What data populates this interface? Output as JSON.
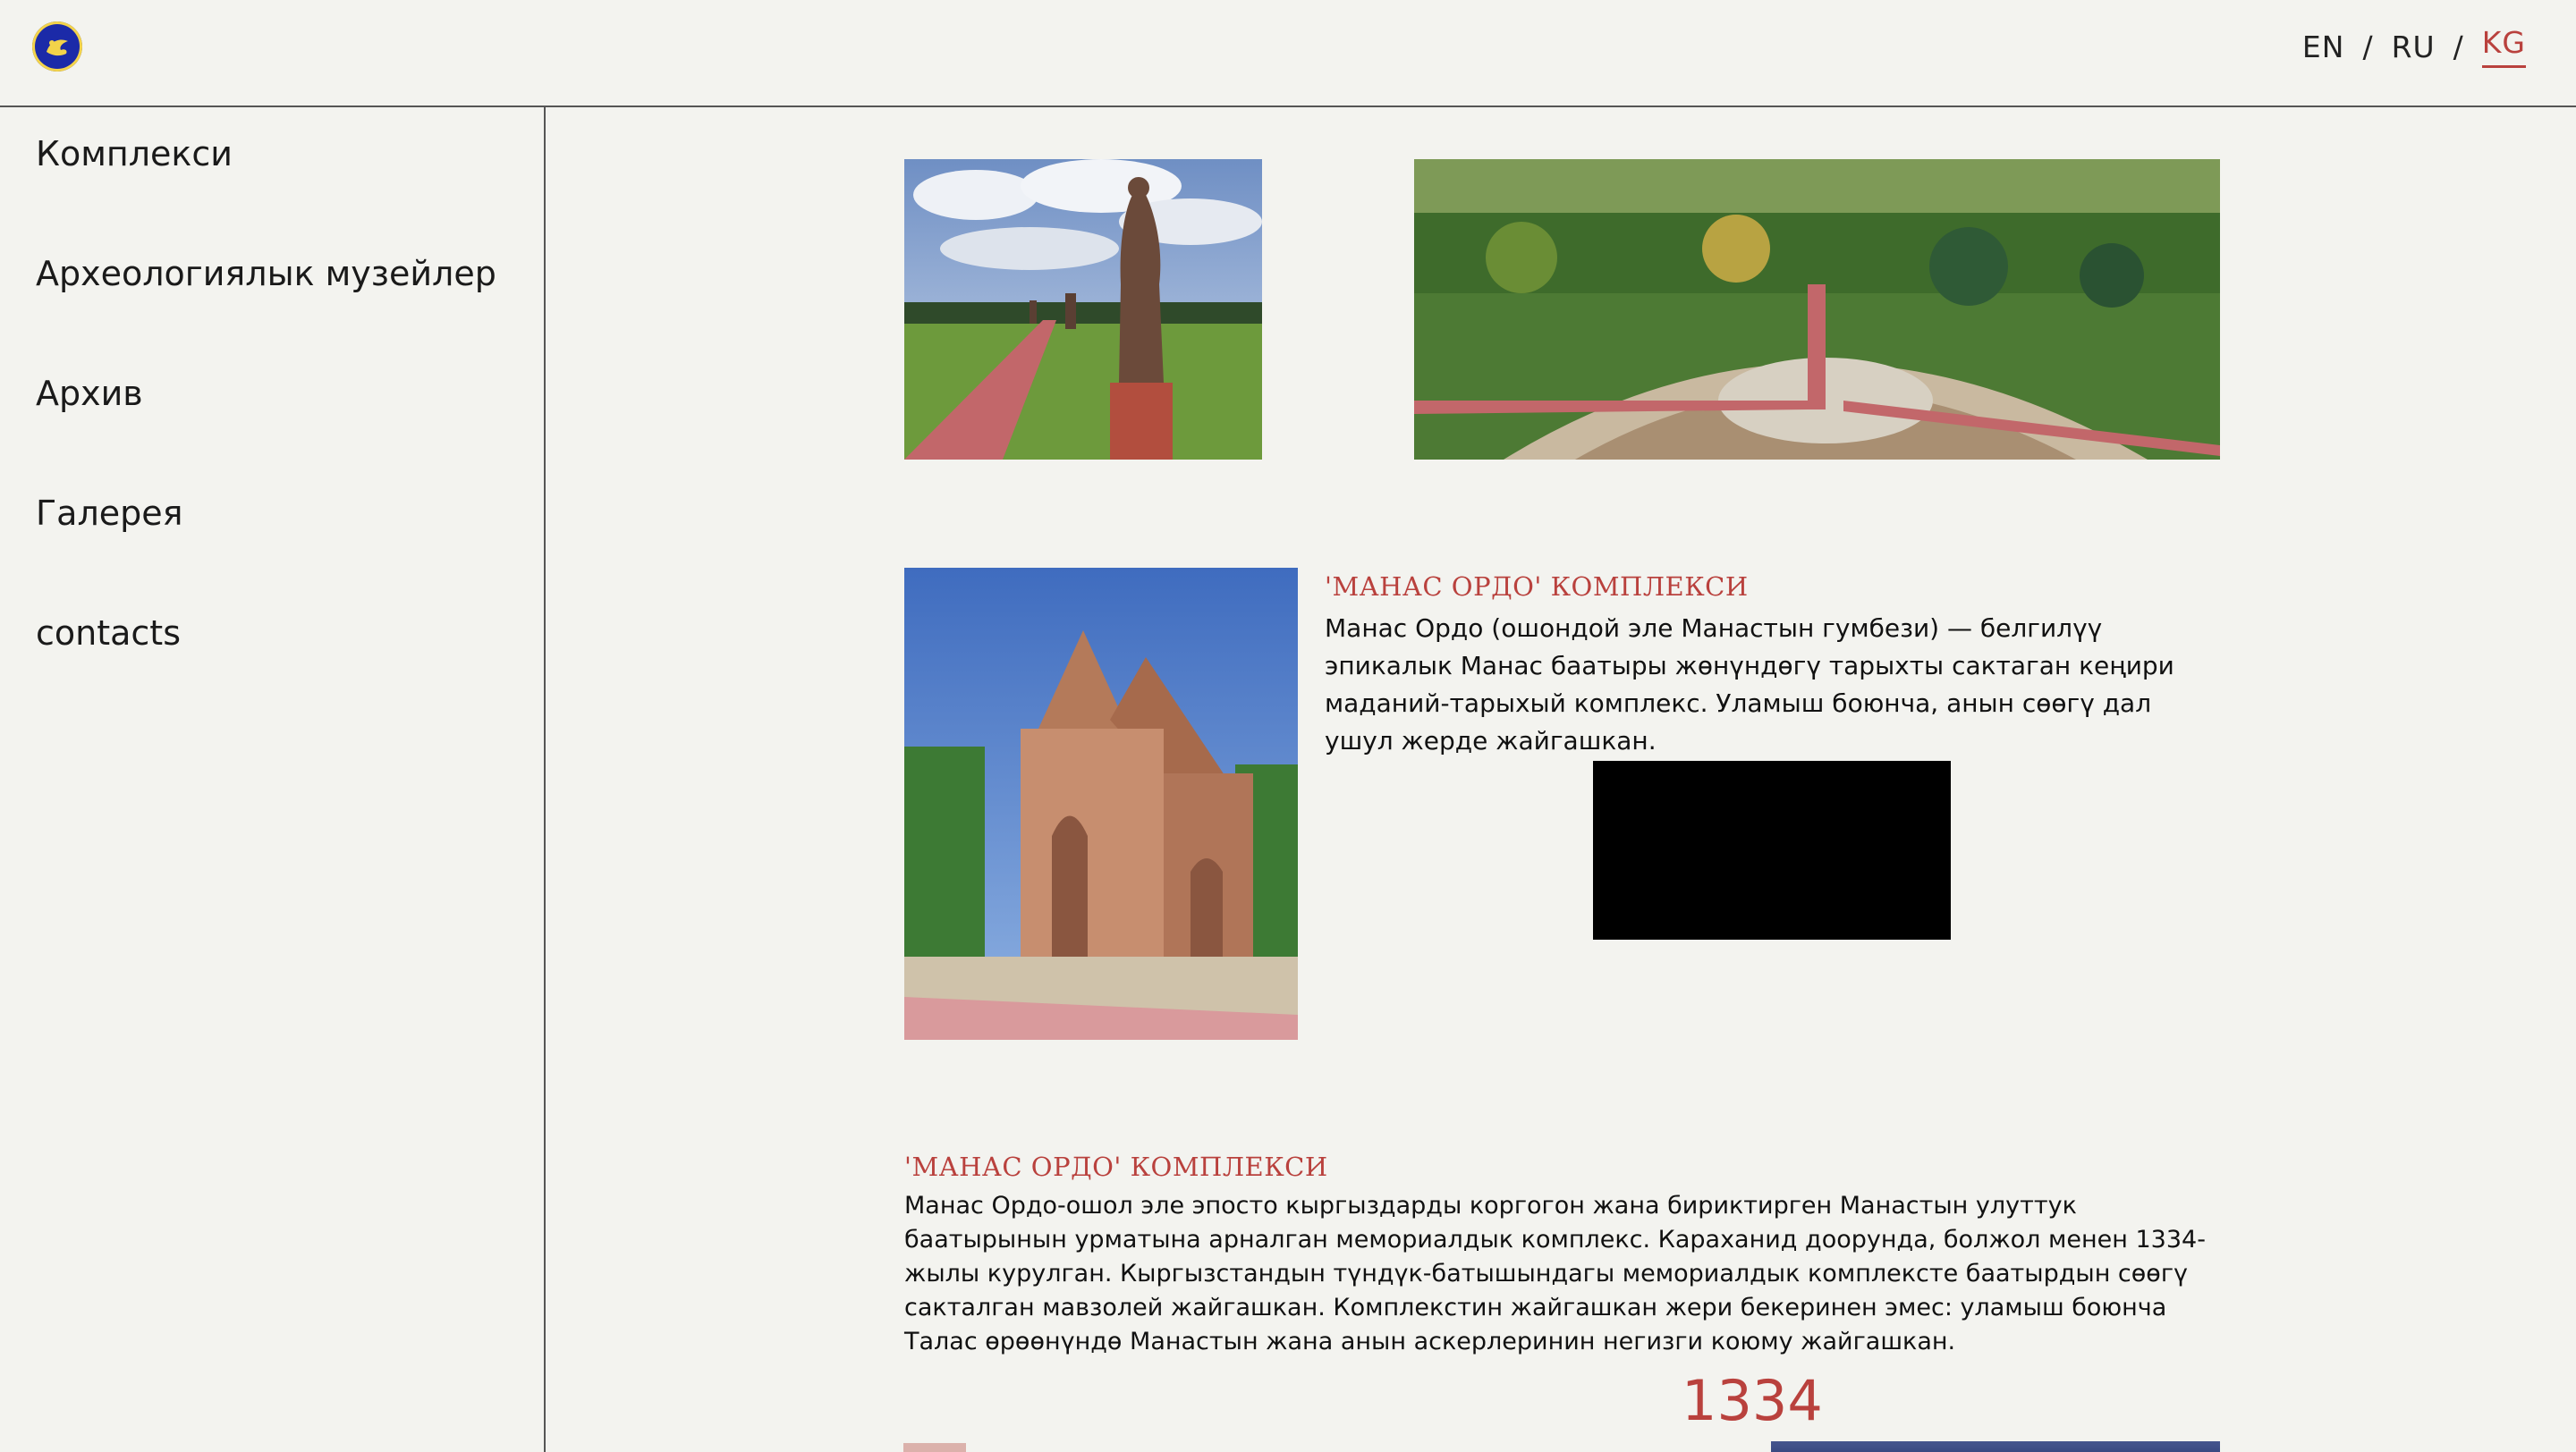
{
  "header": {
    "languages": [
      {
        "label": "EN"
      },
      {
        "label": "RU"
      },
      {
        "label": "KG"
      }
    ],
    "separator": "/",
    "active_language": "KG",
    "colors": {
      "accent": "#b9413d"
    }
  },
  "sidebar": {
    "items": [
      {
        "label": "Комплекси"
      },
      {
        "label": "Археологиялык музейлер"
      },
      {
        "label": "Архив"
      },
      {
        "label": "Галерея"
      },
      {
        "label": "contacts"
      }
    ]
  },
  "main": {
    "section1": {
      "title": "'МАНАС ОРДО' КОМПЛЕКСИ",
      "text": "Манас Ордо (ошондой эле Манастын гумбези) — белгилүү эпикалык Манас баатыры жөнүндөгү тарыхты сактаган кеңири маданий-тарыхый комплекс. Уламыш боюнча, анын сөөгү дал ушул жерде жайгашкан."
    },
    "section2": {
      "title": "'МАНАС ОРДО' КОМПЛЕКСИ",
      "text": "Манас Ордо-ошол эле эпосто кыргыздарды коргогон жана бириктирген Манастын улуттук баатырынын урматына арналган мемориалдык комплекс. Караханид доорунда, болжол менен 1334-жылы курулган. Кыргызстандын түндүк-батышындагы мемориалдык комплексте баатырдын сөөгү сакталган мавзолей жайгашкан. Комплекстин жайгашкан жери бекеринен эмес: уламыш боюнча Талас өрөөнүндө Манастын жана анын аскерлеринин негизги коюму жайгашкан."
    },
    "year": "1334"
  }
}
